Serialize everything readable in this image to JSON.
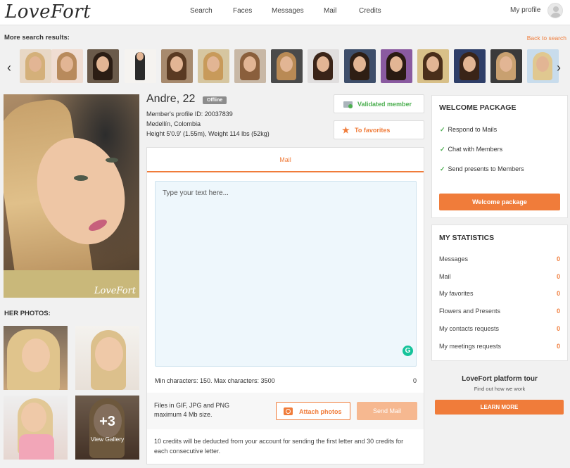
{
  "header": {
    "logo": "LoveFort",
    "nav": [
      "Search",
      "Faces",
      "Messages",
      "Mail",
      "Credits"
    ],
    "my_profile": "My profile"
  },
  "search_results": {
    "label": "More search results:",
    "back_link": "Back to search",
    "prev_icon": "chevron-left-icon",
    "next_icon": "chevron-right-icon"
  },
  "profile": {
    "name": "Andre, 22",
    "status": "Offline",
    "profile_id": "Member's profile ID: 20037839",
    "location": "Medellín, Colombia",
    "stats": "Height 5'0.9' (1.55m), Weight 114 lbs (52kg)",
    "photo_watermark": "LoveFort",
    "her_photos_label": "HER PHOTOS:",
    "gallery_count": "+3",
    "gallery_label": "View Gallery",
    "validated_label": "Validated member",
    "favorites_label": "To favorites"
  },
  "mail": {
    "tab_label": "Mail",
    "placeholder": "Type your text here...",
    "min_max": "Min characters: 150. Max characters: 3500",
    "char_count": "0",
    "files_note": "Files in GIF, JPG and PNG maximum 4 Mb size.",
    "attach_label": "Attach photos",
    "send_label": "Send Mail",
    "credits_note": "10 credits will be deducted from your account for sending the first letter and 30 credits for each consecutive letter."
  },
  "welcome": {
    "title": "WELCOME PACKAGE",
    "items": [
      "Respond to Mails",
      "Chat with Members",
      "Send presents to Members"
    ],
    "button": "Welcome package"
  },
  "statistics": {
    "title": "MY STATISTICS",
    "rows": [
      {
        "label": "Messages",
        "value": "0"
      },
      {
        "label": "Mail",
        "value": "0"
      },
      {
        "label": "My favorites",
        "value": "0"
      },
      {
        "label": "Flowers and Presents",
        "value": "0"
      },
      {
        "label": "My contacts requests",
        "value": "0"
      },
      {
        "label": "My meetings requests",
        "value": "0"
      }
    ]
  },
  "tour": {
    "title": "LoveFort platform tour",
    "subtitle": "Find out how we work",
    "button": "LEARN MORE"
  },
  "colors": {
    "accent": "#f07c3a",
    "success": "#4caf50",
    "offline_badge": "#8c8c8c"
  }
}
